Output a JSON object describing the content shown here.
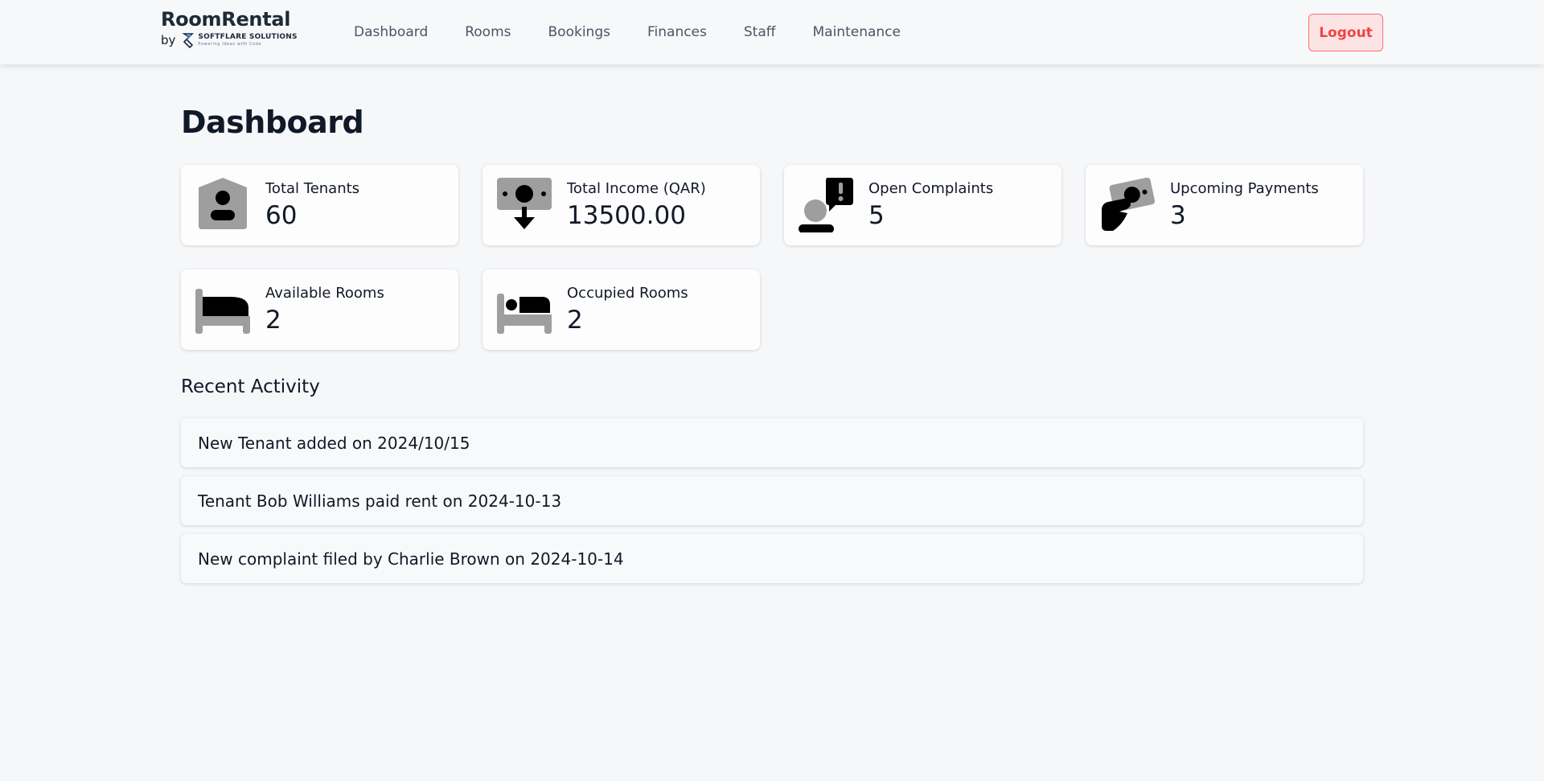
{
  "brand": {
    "title": "RoomRental",
    "by": "by",
    "company_name": "SOFTFLARE SOLUTIONS",
    "company_tagline": "Powering Ideas with Code"
  },
  "nav": {
    "items": [
      {
        "label": "Dashboard"
      },
      {
        "label": "Rooms"
      },
      {
        "label": "Bookings"
      },
      {
        "label": "Finances"
      },
      {
        "label": "Staff"
      },
      {
        "label": "Maintenance"
      }
    ],
    "logout_label": "Logout"
  },
  "page": {
    "title": "Dashboard"
  },
  "stats": [
    {
      "label": "Total Tenants",
      "value": "60",
      "icon": "tenant-badge-icon"
    },
    {
      "label": "Total Income (QAR)",
      "value": "13500.00",
      "icon": "money-download-icon"
    },
    {
      "label": "Open Complaints",
      "value": "5",
      "icon": "person-alert-icon"
    },
    {
      "label": "Upcoming Payments",
      "value": "3",
      "icon": "hand-money-icon"
    },
    {
      "label": "Available Rooms",
      "value": "2",
      "icon": "empty-bed-icon"
    },
    {
      "label": "Occupied Rooms",
      "value": "2",
      "icon": "occupied-bed-icon"
    }
  ],
  "recent_activity": {
    "title": "Recent Activity",
    "items": [
      "New Tenant added on 2024/10/15",
      "Tenant Bob Williams paid rent on 2024-10-13",
      "New complaint filed by Charlie Brown on 2024-10-14"
    ]
  },
  "colors": {
    "background": "#f6f7f9",
    "logout_border": "#f87171",
    "logout_text": "#ef4444",
    "logout_bg": "#fde4e4",
    "icon_gray": "#9e9e9e",
    "icon_black": "#000000"
  }
}
